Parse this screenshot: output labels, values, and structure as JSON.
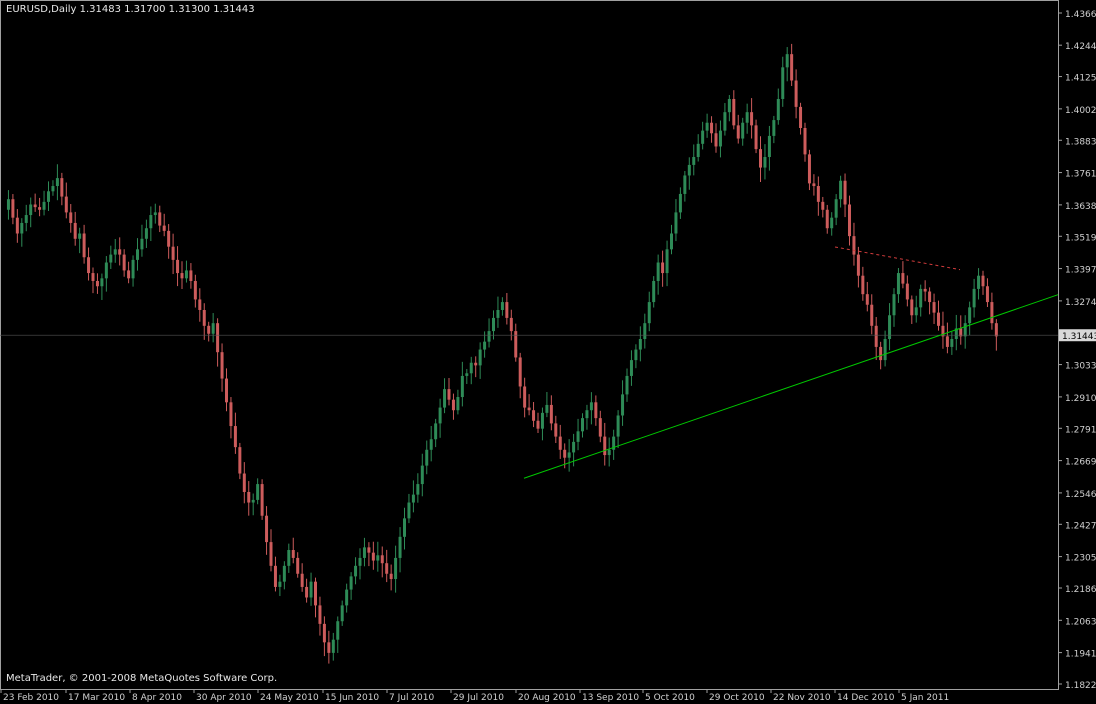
{
  "window": {
    "title": "EURUSD,Daily  1.31483 1.31700 1.31300 1.31443",
    "copyright": "MetaTrader, © 2001-2008 MetaQuotes Software Corp."
  },
  "colors": {
    "background": "#000000",
    "bull": "#2e8b57",
    "bear": "#cd5c5c",
    "grid": "#1f3a1f",
    "axis": "#a0a0a0",
    "support_line": "#00c800",
    "resistance_line": "#d23c3c",
    "price_marker_bg": "#d8d8d8"
  },
  "chart_data": {
    "type": "candlestick",
    "symbol": "EURUSD",
    "timeframe": "Daily",
    "last_ohlc": {
      "open": 1.31483,
      "high": 1.317,
      "low": 1.313,
      "close": 1.31443
    },
    "current_price_label": "1.31443",
    "ylim": [
      1.1822,
      1.4366
    ],
    "y_ticks": [
      "1.43660",
      "1.42440",
      "1.41250",
      "1.40025",
      "1.38835",
      "1.37610",
      "1.36385",
      "1.35195",
      "1.33970",
      "1.32745",
      "1.31555",
      "1.30330",
      "1.29105",
      "1.27915",
      "1.26690",
      "1.25465",
      "1.24275",
      "1.23050",
      "1.21860",
      "1.20635",
      "1.19410",
      "1.18220"
    ],
    "x_ticks": [
      "23 Feb 2010",
      "17 Mar 2010",
      "8 Apr 2010",
      "30 Apr 2010",
      "24 May 2010",
      "15 Jun 2010",
      "7 Jul 2010",
      "29 Jul 2010",
      "20 Aug 2010",
      "13 Sep 2010",
      "5 Oct 2010",
      "29 Oct 2010",
      "22 Nov 2010",
      "14 Dec 2010",
      "5 Jan 2011"
    ],
    "grid": false,
    "closes": [
      1.362,
      1.366,
      1.359,
      1.353,
      1.357,
      1.36,
      1.364,
      1.363,
      1.362,
      1.365,
      1.369,
      1.371,
      1.374,
      1.367,
      1.361,
      1.357,
      1.351,
      1.353,
      1.344,
      1.338,
      1.335,
      1.333,
      1.336,
      1.342,
      1.345,
      1.347,
      1.345,
      1.339,
      1.336,
      1.343,
      1.347,
      1.351,
      1.355,
      1.36,
      1.361,
      1.356,
      1.354,
      1.348,
      1.343,
      1.338,
      1.336,
      1.339,
      1.335,
      1.328,
      1.324,
      1.318,
      1.315,
      1.319,
      1.308,
      1.298,
      1.289,
      1.28,
      1.272,
      1.262,
      1.255,
      1.251,
      1.252,
      1.258,
      1.246,
      1.236,
      1.227,
      1.219,
      1.221,
      1.227,
      1.233,
      1.23,
      1.224,
      1.219,
      1.215,
      1.221,
      1.212,
      1.205,
      1.198,
      1.194,
      1.199,
      1.206,
      1.212,
      1.218,
      1.223,
      1.227,
      1.23,
      1.234,
      1.232,
      1.229,
      1.231,
      1.228,
      1.224,
      1.222,
      1.23,
      1.238,
      1.245,
      1.251,
      1.254,
      1.258,
      1.265,
      1.271,
      1.275,
      1.281,
      1.287,
      1.294,
      1.29,
      1.286,
      1.291,
      1.299,
      1.3,
      1.304,
      1.303,
      1.309,
      1.312,
      1.316,
      1.321,
      1.324,
      1.327,
      1.321,
      1.316,
      1.306,
      1.295,
      1.287,
      1.286,
      1.282,
      1.279,
      1.285,
      1.288,
      1.281,
      1.276,
      1.271,
      1.268,
      1.27,
      1.274,
      1.278,
      1.283,
      1.286,
      1.289,
      1.283,
      1.276,
      1.269,
      1.271,
      1.276,
      1.284,
      1.292,
      1.299,
      1.305,
      1.309,
      1.313,
      1.319,
      1.327,
      1.335,
      1.342,
      1.338,
      1.347,
      1.353,
      1.361,
      1.368,
      1.375,
      1.379,
      1.382,
      1.387,
      1.392,
      1.395,
      1.391,
      1.386,
      1.392,
      1.399,
      1.404,
      1.394,
      1.389,
      1.395,
      1.399,
      1.394,
      1.385,
      1.378,
      1.382,
      1.39,
      1.396,
      1.404,
      1.416,
      1.421,
      1.411,
      1.401,
      1.393,
      1.383,
      1.372,
      1.371,
      1.365,
      1.362,
      1.355,
      1.359,
      1.366,
      1.373,
      1.364,
      1.352,
      1.345,
      1.337,
      1.33,
      1.326,
      1.318,
      1.31,
      1.305,
      1.313,
      1.322,
      1.33,
      1.338,
      1.334,
      1.328,
      1.322,
      1.325,
      1.332,
      1.331,
      1.327,
      1.323,
      1.318,
      1.314,
      1.31,
      1.313,
      1.317,
      1.314,
      1.319,
      1.325,
      1.332,
      1.337,
      1.333,
      1.327,
      1.319,
      1.314
    ],
    "trendlines": [
      {
        "name": "support",
        "from": {
          "x": "20 Aug 2010",
          "price": 1.2602
        },
        "to": {
          "x": "extends right",
          "price": 1.3298
        },
        "style": "solid",
        "color": "#00c800"
      },
      {
        "name": "resistance",
        "from": {
          "x": "14 Dec 2010",
          "price": 1.3479
        },
        "to": {
          "x": "14 Jan 2011",
          "price": 1.3393
        },
        "style": "dashed",
        "color": "#d23c3c"
      }
    ]
  }
}
